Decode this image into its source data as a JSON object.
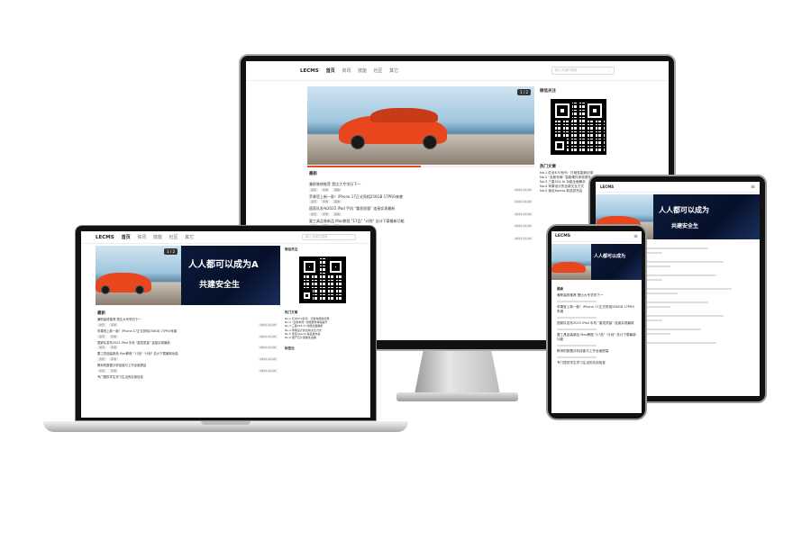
{
  "site": {
    "logo": "LECMS",
    "nav": [
      "首页",
      "资讯",
      "技能",
      "社区",
      "其它"
    ],
    "search_placeholder": "输入关键词搜索"
  },
  "banner": {
    "badge": "1 / 2",
    "dark_text": "人人都可以成为A",
    "dark_sub": "共建安全生",
    "dark_text_small": "人人都可以成为",
    "dark_sub_small": "共建安全生"
  },
  "sidebar": {
    "scan_title": "微信关注",
    "hot_title": "热门文章",
    "hot_items": [
      "No.1 红米K70系列 · 打破性能新纪录",
      "No.2 \"全新布局\" 智能硬件体验提升",
      "No.3 三星S24 AI 功能全面解析",
      "No.4 苹果设计的全新交互方式",
      "No.5 索尼Xperia 新品发布会",
      "No.6 国产芯片突破性进展",
      "No.7 平板电脑市场分析报告"
    ],
    "tag_title": "标签云"
  },
  "latest": {
    "title": "最新",
    "items": [
      {
        "title": "兼职装修推荐 是比大专学历下一",
        "date": "2021-11-18"
      },
      {
        "title": "苹果官上新一款！iPhone 17正式亮相256GB 17PRO来袭",
        "date": "2021-11-18"
      },
      {
        "title": "国家队发布2025 iPad 手机 \"重发质量\" 连接实现最新",
        "date": "2021-11-18"
      },
      {
        "title": "要工具品装新品 Mac教程 \"17品\" \"计划\" 总计下载最新功能",
        "date": "2021-11-18"
      },
      {
        "title": "教师的数据分析技能与工作全面提高",
        "date": "2021-11-18"
      },
      {
        "title": "专门提供学生学习生活的实用信息",
        "date": "2021-11-18"
      }
    ],
    "tags": [
      "资讯",
      "评测",
      "其他"
    ]
  },
  "colors": {
    "car": "#e8461d",
    "frame": "#111111",
    "silver": "#c8c8c8"
  }
}
